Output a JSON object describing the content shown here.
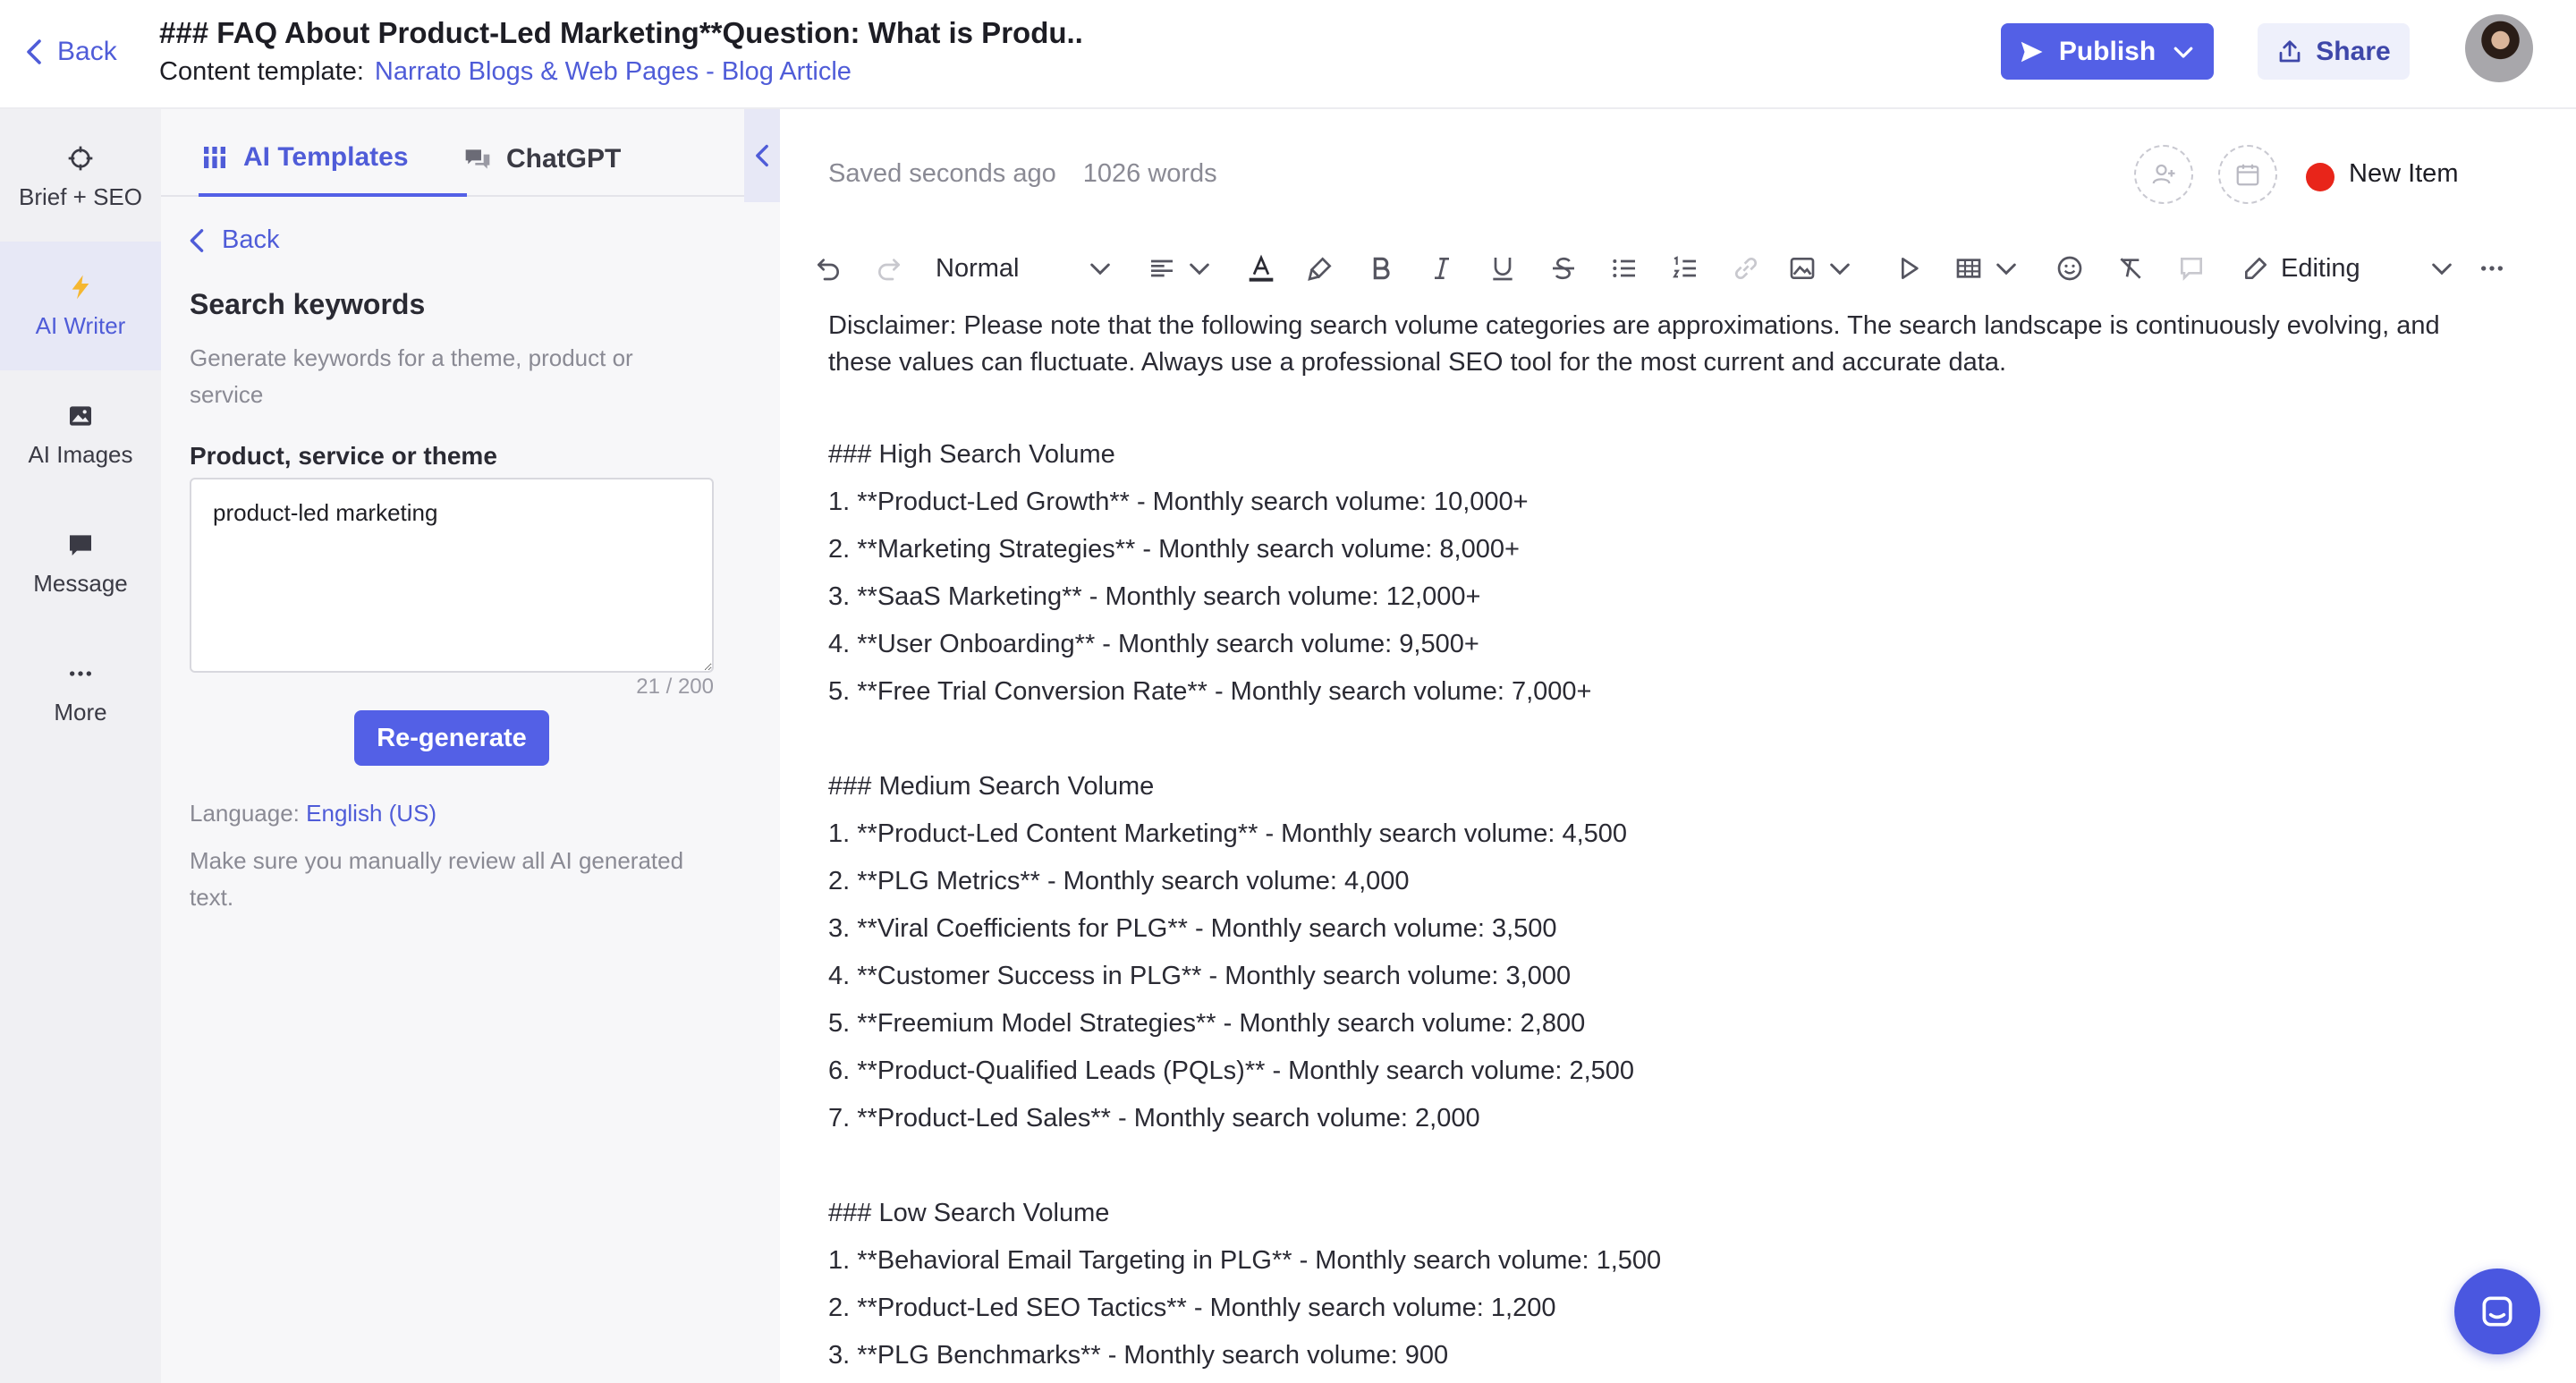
{
  "header": {
    "back_label": "Back",
    "title": "### FAQ About Product-Led Marketing**Question: What is Produ..",
    "template_prefix": "Content template:",
    "template_name": "Narrato Blogs & Web Pages - Blog Article",
    "publish_label": "Publish",
    "share_label": "Share"
  },
  "sidebar": {
    "items": [
      {
        "label": "Brief + SEO",
        "icon": "crosshair-icon"
      },
      {
        "label": "AI Writer",
        "icon": "lightning-icon",
        "active": true
      },
      {
        "label": "AI Images",
        "icon": "image-icon"
      },
      {
        "label": "Message",
        "icon": "chat-bubble-icon"
      },
      {
        "label": "More",
        "icon": "ellipsis-icon"
      }
    ]
  },
  "panel": {
    "tabs": [
      {
        "label": "AI Templates",
        "icon": "templates-icon",
        "active": true
      },
      {
        "label": "ChatGPT",
        "icon": "chat-icon",
        "active": false
      }
    ],
    "back_label": "Back",
    "title": "Search keywords",
    "description": "Generate keywords for a theme, product or service",
    "field_label": "Product, service or theme",
    "field_value": "product-led marketing",
    "char_count": "21 / 200",
    "regenerate_label": "Re-generate",
    "language_prefix": "Language:",
    "language_value": "English (US)",
    "review_note": "Make sure you manually review all AI generated text."
  },
  "editor": {
    "saved_status": "Saved seconds ago",
    "word_count": "1026 words",
    "status_label": "New Item",
    "status_color": "#e8251a",
    "style_value": "Normal",
    "mode_value": "Editing",
    "disclaimer": "Disclaimer: Please note that the following search volume categories are approximations. The search landscape is continuously evolving, and these values can fluctuate. Always use a professional SEO tool for the most current and accurate data.",
    "sections": [
      {
        "heading": "### High Search Volume",
        "items": [
          "1. **Product-Led Growth** - Monthly search volume: 10,000+",
          "2. **Marketing Strategies** - Monthly search volume: 8,000+",
          "3. **SaaS Marketing** - Monthly search volume: 12,000+",
          "4. **User Onboarding** - Monthly search volume: 9,500+",
          "5. **Free Trial Conversion Rate** - Monthly search volume: 7,000+"
        ]
      },
      {
        "heading": "### Medium Search Volume",
        "items": [
          "1. **Product-Led Content Marketing** - Monthly search volume: 4,500",
          "2. **PLG Metrics** - Monthly search volume: 4,000",
          "3. **Viral Coefficients for PLG** - Monthly search volume: 3,500",
          "4. **Customer Success in PLG** - Monthly search volume: 3,000",
          "5. **Freemium Model Strategies** - Monthly search volume: 2,800",
          "6. **Product-Qualified Leads (PQLs)** - Monthly search volume: 2,500",
          "7. **Product-Led Sales** - Monthly search volume: 2,000"
        ]
      },
      {
        "heading": "### Low Search Volume",
        "items": [
          "1. **Behavioral Email Targeting in PLG** - Monthly search volume: 1,500",
          "2. **Product-Led SEO Tactics** - Monthly search volume: 1,200",
          "3. **PLG Benchmarks** - Monthly search volume: 900"
        ]
      }
    ]
  },
  "colors": {
    "accent": "#5360e6",
    "link": "#4f5cd8",
    "rail_bg": "#f0f0f3",
    "panel_bg": "#f7f7f9"
  }
}
